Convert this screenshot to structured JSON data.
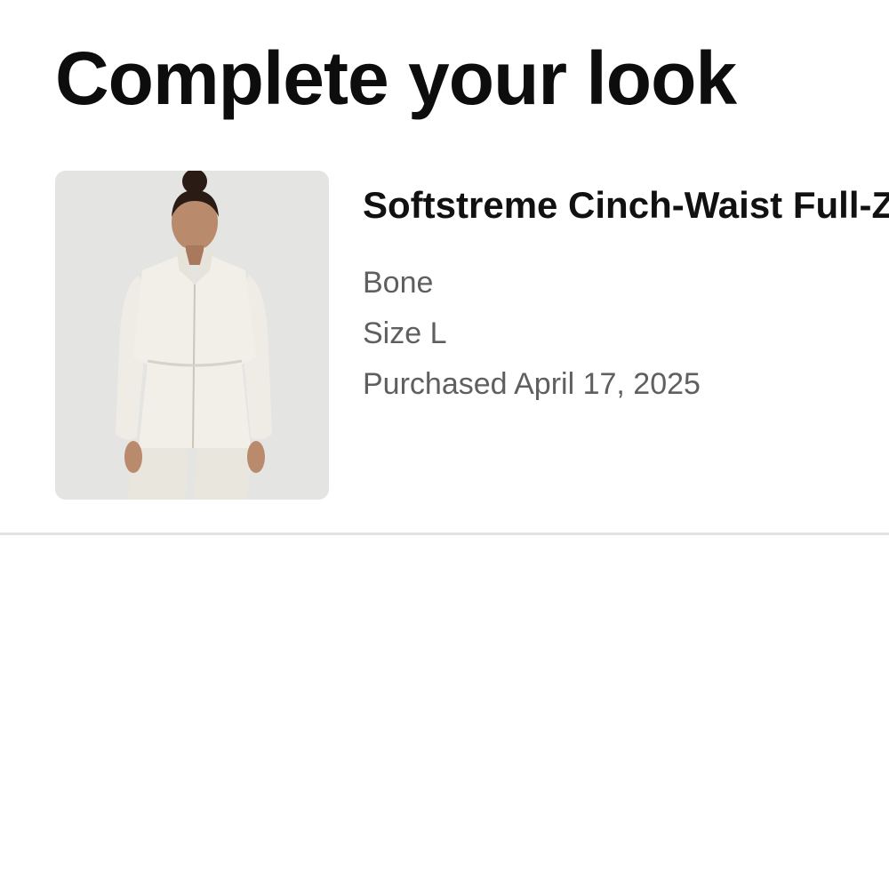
{
  "page": {
    "title": "Complete your look"
  },
  "product": {
    "name": "Softstreme Cinch-Waist Full-Zip Jacket",
    "color": "Bone",
    "size": "Size L",
    "purchased": "Purchased April 17, 2025",
    "image": "product-photo-model-wearing-jacket"
  },
  "colors": {
    "background": "#ffffff",
    "text_primary": "#111111",
    "text_secondary": "#5f5f5f",
    "image_background": "#e4e4e2",
    "divider": "#e2e2e2"
  }
}
